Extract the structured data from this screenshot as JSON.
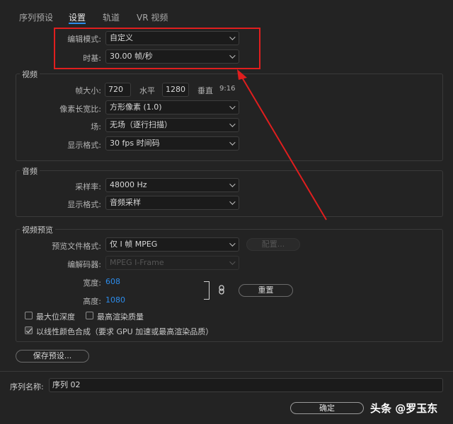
{
  "tabs": [
    {
      "label": "序列预设"
    },
    {
      "label": "设置"
    },
    {
      "label": "轨道"
    },
    {
      "label": "VR 视频"
    }
  ],
  "editing_mode": {
    "label": "编辑模式:",
    "value": "自定义"
  },
  "timebase": {
    "label": "时基:",
    "value": "30.00 帧/秒"
  },
  "video": {
    "section_title": "视频",
    "frame_size_label": "帧大小:",
    "width": "720",
    "horizontal_label": "水平",
    "height": "1280",
    "vertical_label": "垂直",
    "aspect": "9:16",
    "pixel_aspect_label": "像素长宽比:",
    "pixel_aspect_value": "方形像素 (1.0)",
    "fields_label": "场:",
    "fields_value": "无场（逐行扫描）",
    "display_format_label": "显示格式:",
    "display_format_value": "30 fps 时间码"
  },
  "audio": {
    "section_title": "音频",
    "sample_rate_label": "采样率:",
    "sample_rate_value": "48000 Hz",
    "display_format_label": "显示格式:",
    "display_format_value": "音频采样"
  },
  "video_preview": {
    "section_title": "视频预览",
    "preview_format_label": "预览文件格式:",
    "preview_format_value": "仅 I 帧 MPEG",
    "configure_label": "配置...",
    "codec_label": "编解码器:",
    "codec_value": "MPEG I-Frame",
    "width_label": "宽度:",
    "width_value": "608",
    "height_label": "高度:",
    "height_value": "1080",
    "reset_label": "重置",
    "max_bit_depth_label": "最大位深度",
    "max_render_quality_label": "最高渲染质量",
    "linear_color_label": "以线性颜色合成（要求 GPU 加速或最高渲染品质）",
    "max_bit_depth_checked": false,
    "max_render_quality_checked": false,
    "linear_color_checked": true
  },
  "save_preset_label": "保存预设...",
  "sequence_name_label": "序列名称:",
  "sequence_name_value": "序列 02",
  "ok_label": "确定",
  "watermark": "头条 @罗玉东",
  "colors": {
    "highlight": "#e01e1e",
    "accent": "#2d8ceb"
  }
}
